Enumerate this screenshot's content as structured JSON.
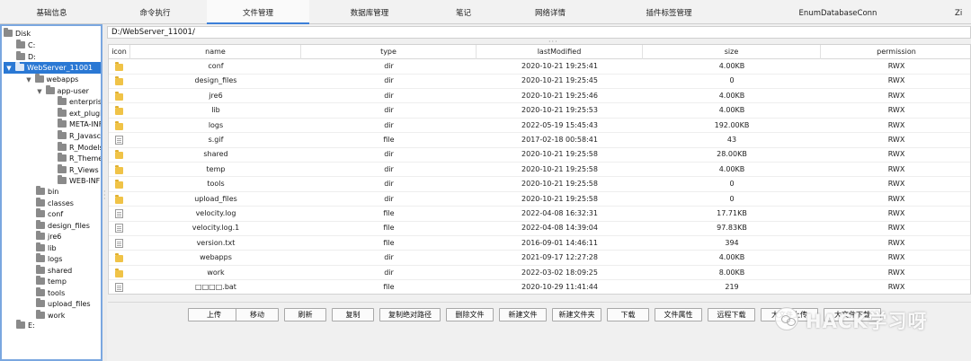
{
  "tabs": [
    {
      "label": "基础信息"
    },
    {
      "label": "命令执行"
    },
    {
      "label": "文件管理"
    },
    {
      "label": "数据库管理"
    },
    {
      "label": "笔记"
    },
    {
      "label": "网络详情"
    },
    {
      "label": "插件标签管理"
    },
    {
      "label": "EnumDatabaseConn"
    },
    {
      "label": "Zi"
    }
  ],
  "tree": [
    {
      "label": "Disk"
    },
    {
      "label": "C:"
    },
    {
      "label": "D:"
    },
    {
      "label": "WebServer_11001"
    },
    {
      "label": "webapps"
    },
    {
      "label": "app-user"
    },
    {
      "label": "enterprise"
    },
    {
      "label": "ext_plugin"
    },
    {
      "label": "META-INF"
    },
    {
      "label": "R_Javascri"
    },
    {
      "label": "R_Models"
    },
    {
      "label": "R_Themes"
    },
    {
      "label": "R_Views"
    },
    {
      "label": "WEB-INF"
    },
    {
      "label": "bin"
    },
    {
      "label": "classes"
    },
    {
      "label": "conf"
    },
    {
      "label": "design_files"
    },
    {
      "label": "jre6"
    },
    {
      "label": "lib"
    },
    {
      "label": "logs"
    },
    {
      "label": "shared"
    },
    {
      "label": "temp"
    },
    {
      "label": "tools"
    },
    {
      "label": "upload_files"
    },
    {
      "label": "work"
    },
    {
      "label": "E:"
    }
  ],
  "path": "D:/WebServer_11001/",
  "table": {
    "headers": [
      "icon",
      "name",
      "type",
      "lastModified",
      "size",
      "permission"
    ],
    "rows": [
      {
        "name": "conf",
        "type": "dir",
        "modified": "2020-10-21 19:25:41",
        "size": "4.00KB",
        "perm": "RWX"
      },
      {
        "name": "design_files",
        "type": "dir",
        "modified": "2020-10-21 19:25:45",
        "size": "0",
        "perm": "RWX"
      },
      {
        "name": "jre6",
        "type": "dir",
        "modified": "2020-10-21 19:25:46",
        "size": "4.00KB",
        "perm": "RWX"
      },
      {
        "name": "lib",
        "type": "dir",
        "modified": "2020-10-21 19:25:53",
        "size": "4.00KB",
        "perm": "RWX"
      },
      {
        "name": "logs",
        "type": "dir",
        "modified": "2022-05-19 15:45:43",
        "size": "192.00KB",
        "perm": "RWX"
      },
      {
        "name": "s.gif",
        "type": "file",
        "modified": "2017-02-18 00:58:41",
        "size": "43",
        "perm": "RWX"
      },
      {
        "name": "shared",
        "type": "dir",
        "modified": "2020-10-21 19:25:58",
        "size": "28.00KB",
        "perm": "RWX"
      },
      {
        "name": "temp",
        "type": "dir",
        "modified": "2020-10-21 19:25:58",
        "size": "4.00KB",
        "perm": "RWX"
      },
      {
        "name": "tools",
        "type": "dir",
        "modified": "2020-10-21 19:25:58",
        "size": "0",
        "perm": "RWX"
      },
      {
        "name": "upload_files",
        "type": "dir",
        "modified": "2020-10-21 19:25:58",
        "size": "0",
        "perm": "RWX"
      },
      {
        "name": "velocity.log",
        "type": "file",
        "modified": "2022-04-08 16:32:31",
        "size": "17.71KB",
        "perm": "RWX"
      },
      {
        "name": "velocity.log.1",
        "type": "file",
        "modified": "2022-04-08 14:39:04",
        "size": "97.83KB",
        "perm": "RWX"
      },
      {
        "name": "version.txt",
        "type": "file",
        "modified": "2016-09-01 14:46:11",
        "size": "394",
        "perm": "RWX"
      },
      {
        "name": "webapps",
        "type": "dir",
        "modified": "2021-09-17 12:27:28",
        "size": "4.00KB",
        "perm": "RWX"
      },
      {
        "name": "work",
        "type": "dir",
        "modified": "2022-03-02 18:09:25",
        "size": "8.00KB",
        "perm": "RWX"
      },
      {
        "name": "□□□□.bat",
        "type": "file",
        "modified": "2020-10-29 11:41:44",
        "size": "219",
        "perm": "RWX"
      }
    ]
  },
  "buttons": [
    {
      "label": "上传"
    },
    {
      "label": "移动"
    },
    {
      "label": "刷新"
    },
    {
      "label": "复制"
    },
    {
      "label": "复制绝对路径"
    },
    {
      "label": "删除文件"
    },
    {
      "label": "新建文件"
    },
    {
      "label": "新建文件夹"
    },
    {
      "label": "下载"
    },
    {
      "label": "文件属性"
    },
    {
      "label": "远程下载"
    },
    {
      "label": "大文件上传"
    },
    {
      "label": "大文件下载"
    }
  ],
  "watermark": {
    "text": "HACK学习呀",
    "icon": "wechat-icon"
  }
}
